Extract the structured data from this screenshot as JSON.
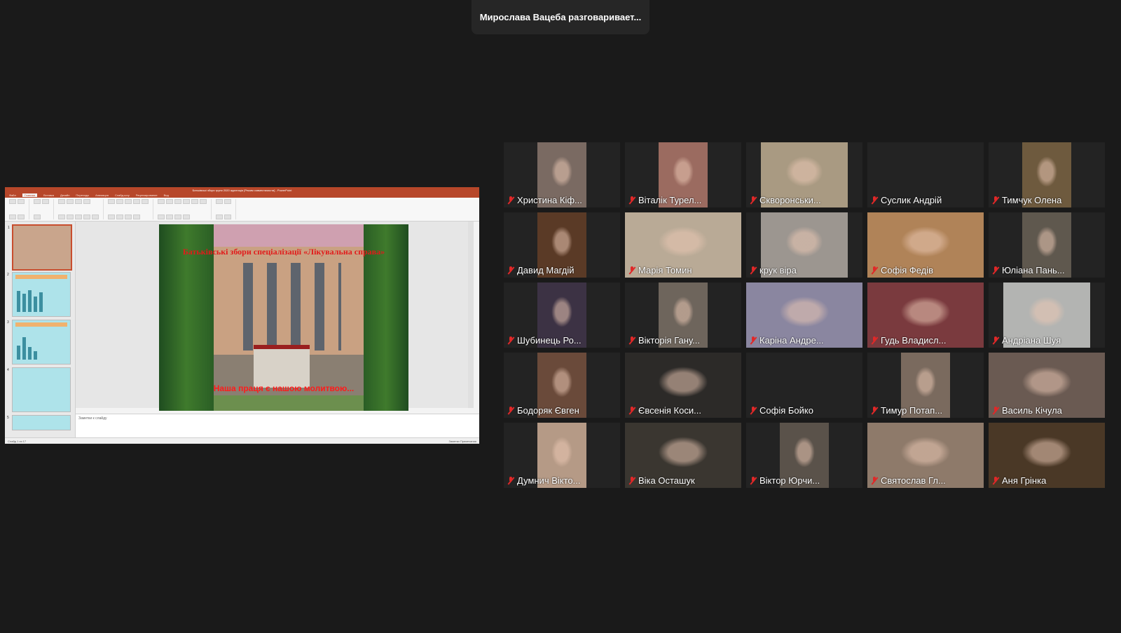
{
  "speaker_banner": "Мирослава Вацеба разговаривает...",
  "share": {
    "window_title": "Батьківські збори групи 2020 адаптація [Режим совместимости] - PowerPoint",
    "ribbon_tabs": [
      "Файл",
      "Главная",
      "Вставка",
      "Дизайн",
      "Переходы",
      "Анимация",
      "Слайд-шоу",
      "Рецензирование",
      "Вид"
    ],
    "active_tab": "Главная",
    "slide_title": "Батьківські збори спеціалізації «Лікувальна справа»",
    "slide_motto": "Наша праця є нашою молитвою...",
    "notes_placeholder": "Заметки к слайду",
    "status_left": "Слайд 1 из 17",
    "status_right": "Заметки    Примечания",
    "thumb_numbers": [
      "1",
      "2",
      "3",
      "4",
      "5"
    ]
  },
  "participants": [
    {
      "name": "Христина Кіф...",
      "color": "#7a6a62"
    },
    {
      "name": "Віталік Турел...",
      "color": "#9b6b60"
    },
    {
      "name": "Скворонськи...",
      "color": "#a99a82"
    },
    {
      "name": "Суслик Андрій",
      "color": ""
    },
    {
      "name": "Тимчук Олена",
      "color": "#6e5a3e"
    },
    {
      "name": "Давид Магдій",
      "color": "#5a3a26"
    },
    {
      "name": "Марія Томин",
      "color": "#b9aa96"
    },
    {
      "name": "крук віра",
      "color": "#9c9690"
    },
    {
      "name": "Софія Федів",
      "color": "#b08358"
    },
    {
      "name": "Юліана Пань...",
      "color": "#5f584e"
    },
    {
      "name": "Шубинець Ро...",
      "color": "#3c3244"
    },
    {
      "name": "Вікторія Гану...",
      "color": "#6e655c"
    },
    {
      "name": "Каріна Андре...",
      "color": "#8a86a0"
    },
    {
      "name": "Гудь Владисл...",
      "color": "#7a3a3e"
    },
    {
      "name": "Андріана Шуя",
      "color": "#b3b4b2"
    },
    {
      "name": "Бодоряк Євген",
      "color": "#6a4a3a"
    },
    {
      "name": "Євсенія Коси...",
      "color": "#2c2a28"
    },
    {
      "name": "Софія Бойко",
      "color": ""
    },
    {
      "name": "Тимур Потап...",
      "color": "#7a6a5e"
    },
    {
      "name": "Василь Кічула",
      "color": "#6a5a52"
    },
    {
      "name": "Думнич Вікто...",
      "color": "#b59a86"
    },
    {
      "name": "Віка Осташук",
      "color": "#3a3630"
    },
    {
      "name": "Віктор Юрчи...",
      "color": "#5a524a"
    },
    {
      "name": "Святослав Гл...",
      "color": "#8e7a6a"
    },
    {
      "name": "Аня Грінка",
      "color": "#4a3826"
    }
  ]
}
